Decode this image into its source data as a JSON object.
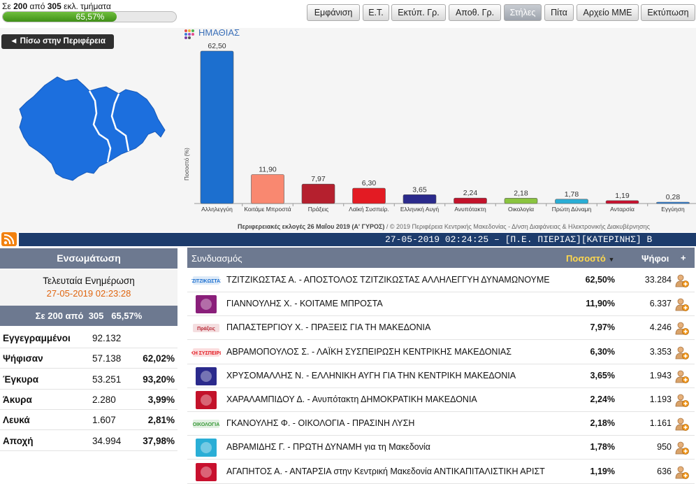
{
  "progress": {
    "prefix": "Σε",
    "counted": "200",
    "mid": "από",
    "total": "305",
    "suffix": "εκλ. τμήματα",
    "percent_label": "65,57%",
    "fraction": 0.6557
  },
  "toolbar": [
    "Εμφάνιση",
    "Ε.Τ.",
    "Εκτύπ. Γρ.",
    "Αποθ. Γρ.",
    "Στήλες",
    "Πίτα",
    "Αρχείο ΜΜΕ",
    "Εκτύπωση"
  ],
  "toolbar_active": "Στήλες",
  "back_button": "◄ Πίσω στην Περιφέρεια",
  "region_title": "ΗΜΑΘΙΑΣ",
  "chart_data": {
    "type": "bar",
    "ylabel": "Ποσοστό (%)",
    "categories": [
      "Αλληλεγγύη",
      "Κοιτάμε Μπροστά",
      "Πράξεις",
      "Λαϊκή Συσπείρ.",
      "Ελληνική Αυγή",
      "Ανυπότακτη",
      "Οικολογία",
      "Πρώτη Δύναμη",
      "Ανταρσία",
      "Εγγύηση"
    ],
    "values": [
      62.5,
      11.9,
      7.97,
      6.3,
      3.65,
      2.24,
      2.18,
      1.78,
      1.19,
      0.28
    ],
    "value_labels": [
      "62,50",
      "11,90",
      "7,97",
      "6,30",
      "3,65",
      "2,24",
      "2,18",
      "1,78",
      "1,19",
      "0,28"
    ],
    "colors": [
      "#1c6fcf",
      "#f98870",
      "#b5202e",
      "#e31b23",
      "#2b2a8c",
      "#c3122a",
      "#8ac43f",
      "#2aaed6",
      "#c8102e",
      "#2d7fd8"
    ],
    "ylim": [
      0,
      62.5
    ],
    "grid": false
  },
  "chart_footer": {
    "bold": "Περιφερειακές εκλογές 26 Μαΐου 2019 (Α' ΓΥΡΟΣ)",
    "rest": " / © 2019 Περιφέρεια Κεντρικής Μακεδονίας - Δ/νση Διαφάνειας & Ηλεκτρονικής Διακυβέρνησης"
  },
  "ticker": "27-05-2019 02:24:25 – [Π.Ε. ΠΙΕΡΙΑΣ][ΚΑΤΕΡΙΝΗΣ] Β",
  "left_panel": {
    "title": "Ενσωμάτωση",
    "last_update_label": "Τελευταία Ενημέρωση",
    "last_update_value": "27-05-2019 02:23:28",
    "summary": {
      "a": "Σε 200 από",
      "b": "305",
      "c": "65,57%"
    },
    "stats": [
      {
        "label": "Εγγεγραμμένοι",
        "value": "92.132",
        "pct": ""
      },
      {
        "label": "Ψήφισαν",
        "value": "57.138",
        "pct": "62,02%"
      },
      {
        "label": "Έγκυρα",
        "value": "53.251",
        "pct": "93,20%"
      },
      {
        "label": "Άκυρα",
        "value": "2.280",
        "pct": "3,99%"
      },
      {
        "label": "Λευκά",
        "value": "1.607",
        "pct": "2,81%"
      },
      {
        "label": "Αποχή",
        "value": "34.994",
        "pct": "37,98%"
      }
    ]
  },
  "table": {
    "headers": {
      "name": "Συνδυασμός",
      "pct": "Ποσοστό",
      "votes": "Ψήφοι",
      "plus": "+"
    },
    "rows": [
      {
        "name": "ΤΖΙΤΖΙΚΩΣΤΑΣ Α. - ΑΠΟΣΤΟΛΟΣ ΤΖΙΤΖΙΚΩΣΤΑΣ ΑΛΛΗΛΕΓΓΥΗ ΔΥΝΑΜΩΝΟΥΜΕ",
        "pct": "62,50%",
        "votes": "33.284",
        "logo_text": "ΤΖΙΤΖΙΚΩΣΤΑΣ",
        "logo_color": "#1c6fcf"
      },
      {
        "name": "ΓΙΑΝΝΟΥΛΗΣ Χ. - ΚΟΙΤΑΜΕ ΜΠΡΟΣΤΑ",
        "pct": "11,90%",
        "votes": "6.337",
        "logo_text": "",
        "logo_color": "#8a1f7a"
      },
      {
        "name": "ΠΑΠΑΣΤΕΡΓΙΟΥ Χ. - ΠΡΑΞΕΙΣ ΓΙΑ ΤΗ ΜΑΚΕΔΟΝΙΑ",
        "pct": "7,97%",
        "votes": "4.246",
        "logo_text": "Πράξεις",
        "logo_color": "#b5202e"
      },
      {
        "name": "ΑΒΡΑΜΟΠΟΥΛΟΣ Σ. - ΛΑΪΚΗ ΣΥΣΠΕΙΡΩΣΗ ΚΕΝΤΡΙΚΗΣ ΜΑΚΕΔΟΝΙΑΣ",
        "pct": "6,30%",
        "votes": "3.353",
        "logo_text": "ΛΑΪΚΗ ΣΥΣΠΕΙΡΩΣΗ",
        "logo_color": "#e31b23"
      },
      {
        "name": "ΧΡΥΣΟΜΑΛΛΗΣ Ν. - ΕΛΛΗΝΙΚΗ ΑΥΓΗ ΓΙΑ ΤΗΝ ΚΕΝΤΡΙΚΗ ΜΑΚΕΔΟΝΙΑ",
        "pct": "3,65%",
        "votes": "1.943",
        "logo_text": "",
        "logo_color": "#2b2a8c"
      },
      {
        "name": "ΧΑΡΑΛΑΜΠΙΔΟΥ Δ. - Ανυπότακτη ΔΗΜΟΚΡΑΤΙΚΗ ΜΑΚΕΔΟΝΙΑ",
        "pct": "2,24%",
        "votes": "1.193",
        "logo_text": "",
        "logo_color": "#c3122a"
      },
      {
        "name": "ΓΚΑΝΟΥΛΗΣ Φ. - ΟΙΚΟΛΟΓΙΑ - ΠΡΑΣΙΝΗ ΛΥΣΗ",
        "pct": "2,18%",
        "votes": "1.161",
        "logo_text": "ΟΙΚΟΛΟΓΙΑ",
        "logo_color": "#3a9a3a"
      },
      {
        "name": "ΑΒΡΑΜΙΔΗΣ Γ. - ΠΡΩΤΗ ΔΥΝΑΜΗ για τη Μακεδονία",
        "pct": "1,78%",
        "votes": "950",
        "logo_text": "",
        "logo_color": "#2aaed6"
      },
      {
        "name": "ΑΓΑΠΗΤΟΣ Α. - ΑΝΤΑΡΣΙΑ στην Κεντρική Μακεδονία ΑΝΤΙΚΑΠΙΤΑΛΙΣΤΙΚΗ ΑΡΙΣΤ",
        "pct": "1,19%",
        "votes": "636",
        "logo_text": "",
        "logo_color": "#c8102e"
      }
    ]
  }
}
